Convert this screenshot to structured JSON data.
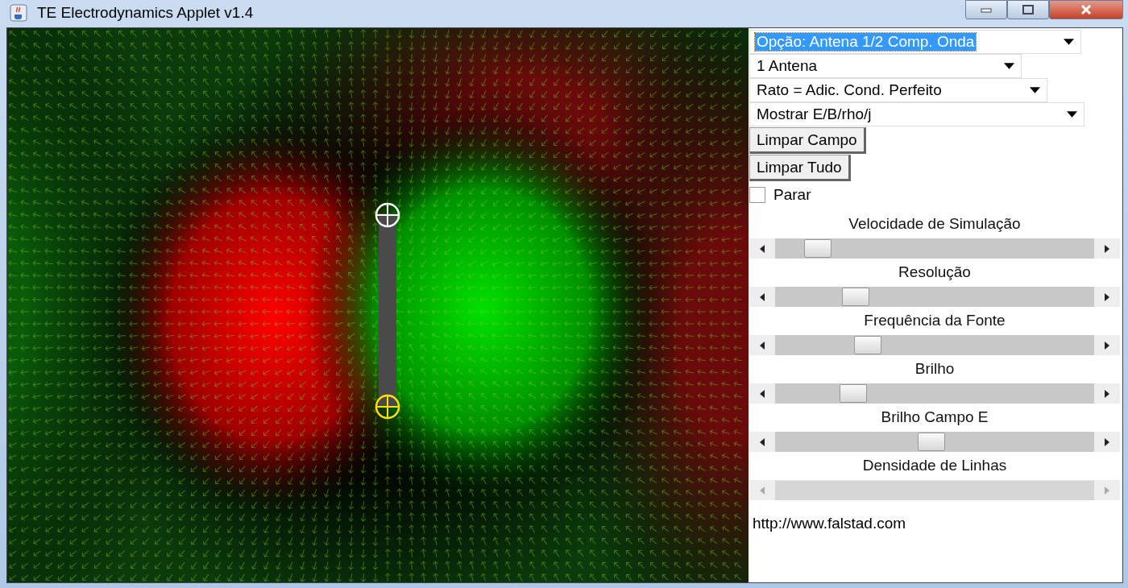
{
  "window": {
    "title": "TE Electrodynamics Applet v1.4"
  },
  "dropdowns": [
    {
      "value": "Opção: Antena 1/2 Comp. Onda",
      "focused": true
    },
    {
      "value": "1 Antena",
      "focused": false
    },
    {
      "value": "Rato = Adic. Cond. Perfeito",
      "focused": false
    },
    {
      "value": "Mostrar E/B/rho/j",
      "focused": false
    }
  ],
  "buttons": [
    "Limpar Campo",
    "Limpar Tudo"
  ],
  "checkbox": {
    "label": "Parar",
    "checked": false
  },
  "sliders": [
    {
      "label": "Velocidade de Simulação",
      "level": 0.1,
      "disabled": false
    },
    {
      "label": "Resolução",
      "level": 0.23,
      "disabled": false
    },
    {
      "label": "Frequência da Fonte",
      "level": 0.27,
      "disabled": false
    },
    {
      "label": "Brilho",
      "level": 0.22,
      "disabled": false
    },
    {
      "label": "Brilho Campo E",
      "level": 0.49,
      "disabled": false
    },
    {
      "label": "Densidade de Linhas",
      "disabled": true
    }
  ],
  "link": "http://www.falstad.com"
}
